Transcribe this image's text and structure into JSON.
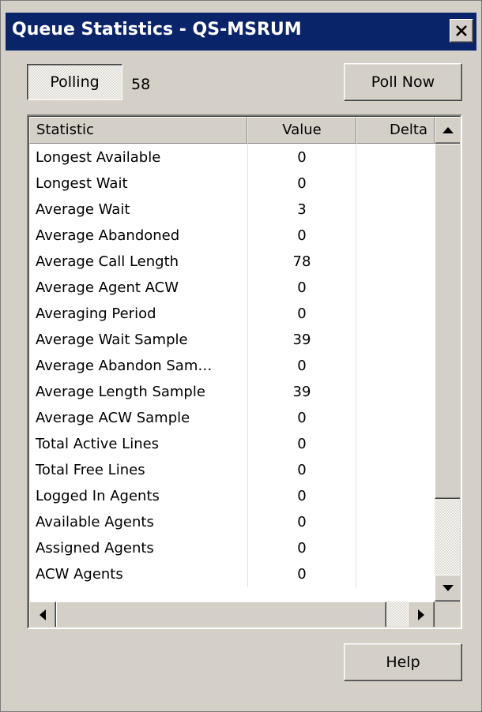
{
  "window": {
    "title": "Queue Statistics - QS-MSRUM"
  },
  "controls": {
    "polling_label": "Polling",
    "poll_count": "58",
    "poll_now_label": "Poll Now",
    "help_label": "Help"
  },
  "table": {
    "columns": [
      "Statistic",
      "Value",
      "Delta"
    ],
    "rows": [
      {
        "statistic": "Longest Available",
        "value": "0",
        "delta": ""
      },
      {
        "statistic": "Longest Wait",
        "value": "0",
        "delta": ""
      },
      {
        "statistic": "Average Wait",
        "value": "3",
        "delta": ""
      },
      {
        "statistic": "Average Abandoned",
        "value": "0",
        "delta": ""
      },
      {
        "statistic": "Average Call Length",
        "value": "78",
        "delta": ""
      },
      {
        "statistic": "Average Agent ACW",
        "value": "0",
        "delta": ""
      },
      {
        "statistic": "Averaging Period",
        "value": "0",
        "delta": ""
      },
      {
        "statistic": "Average Wait Sample",
        "value": "39",
        "delta": ""
      },
      {
        "statistic": "Average Abandon Sam…",
        "value": "0",
        "delta": ""
      },
      {
        "statistic": "Average Length Sample",
        "value": "39",
        "delta": ""
      },
      {
        "statistic": "Average ACW Sample",
        "value": "0",
        "delta": ""
      },
      {
        "statistic": "Total Active Lines",
        "value": "0",
        "delta": ""
      },
      {
        "statistic": "Total Free Lines",
        "value": "0",
        "delta": ""
      },
      {
        "statistic": "Logged In Agents",
        "value": "0",
        "delta": ""
      },
      {
        "statistic": "Available Agents",
        "value": "0",
        "delta": ""
      },
      {
        "statistic": "Assigned Agents",
        "value": "0",
        "delta": ""
      },
      {
        "statistic": "ACW Agents",
        "value": "0",
        "delta": ""
      }
    ]
  },
  "icons": {
    "close": "close-icon",
    "sort": "sort-ascending-icon",
    "scroll_up": "arrow-up-icon",
    "scroll_down": "arrow-down-icon",
    "scroll_left": "arrow-left-icon",
    "scroll_right": "arrow-right-icon"
  },
  "colors": {
    "titlebar": "#0a246a",
    "face": "#d4d0c8"
  }
}
